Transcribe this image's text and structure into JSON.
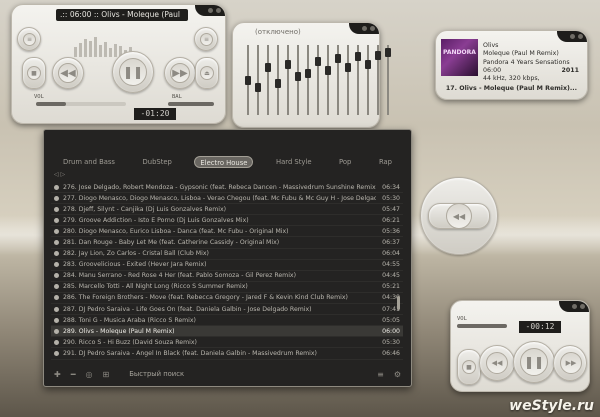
{
  "mini_player": {
    "title": ".:: 06:00 :: Olivs - Moleque (Paul",
    "time": "-01:20",
    "label_vol": "VOL",
    "label_bal": "BAL"
  },
  "equalizer": {
    "status": "(отключено)",
    "bands": [
      0.5,
      0.62,
      0.3,
      0.55,
      0.25,
      0.45,
      0.4,
      0.2,
      0.35,
      0.15,
      0.3,
      0.12,
      0.25,
      0.1,
      0.05
    ]
  },
  "now_playing": {
    "artist": "Olivs",
    "track": "Moleque (Paul M Remix)",
    "album": "Pandora 4 Years Sensations",
    "time": "06:00",
    "year": "2011",
    "format": "44 kHz, 320 kbps,",
    "art_text": "PANDORA",
    "footer": "17. Olivs - Moleque (Paul M Remix)..."
  },
  "playlist": {
    "tabs": [
      {
        "label": "Drum and Bass",
        "active": false
      },
      {
        "label": "DubStep",
        "active": false
      },
      {
        "label": "Electro House",
        "active": true
      },
      {
        "label": "Hard Style",
        "active": false
      },
      {
        "label": "Pop",
        "active": false
      },
      {
        "label": "Rap",
        "active": false
      }
    ],
    "nav": "◁ ▷",
    "rows": [
      {
        "title": "276. Jose Delgado, Robert Mendoza - Gypsonic (feat. Rebeca Dancen - Massivedrum Sunshine Remix)",
        "dur": "06:34"
      },
      {
        "title": "277. Diogo Menasco, Diogo Menasco, Lisboa - Verao Chegou (feat. Mc Fubu & Mc Guy H - Jose Delgado Remix)",
        "dur": "05:30"
      },
      {
        "title": "278. Djeff, Silynt - Canjika (Dj Luis Gonzalves Remix)",
        "dur": "05:47"
      },
      {
        "title": "279. Groove Addiction - Isto E Porno (Dj Luis Gonzalves Mix)",
        "dur": "06:21"
      },
      {
        "title": "280. Diogo Menasco, Eurico Lisboa - Danca (feat. Mc Fubu - Original Mix)",
        "dur": "05:36"
      },
      {
        "title": "281. Dan Rouge - Baby Let Me (feat. Catherine Cassidy - Original Mix)",
        "dur": "06:37"
      },
      {
        "title": "282. Jay Lion, Zo Carlos - Cristal Ball (Club Mix)",
        "dur": "06:04"
      },
      {
        "title": "283. Groovelicious - Exited (Hever Jara Remix)",
        "dur": "04:55"
      },
      {
        "title": "284. Manu Serrano - Red Rose 4 Her (feat. Pablo Somoza - Gil Perez Remix)",
        "dur": "04:45"
      },
      {
        "title": "285. Marcello Totti - All Night Long (Ricco S Summer Remix)",
        "dur": "05:21"
      },
      {
        "title": "286. The Foreign Brothers - Move (feat. Rebecca Gregory - Jared F & Kevin Kind Club Remix)",
        "dur": "04:30"
      },
      {
        "title": "287. DJ Pedro Saraiva - Life Goes On (feat. Daniela Galbin - Jose Delgado Remix)",
        "dur": "07:41"
      },
      {
        "title": "288. Toni G - Musica Araba (Ricco S Remix)",
        "dur": "05:05"
      },
      {
        "title": "289. Olivs - Moleque (Paul M Remix)",
        "dur": "06:00",
        "current": true
      },
      {
        "title": "290. Ricco S - Hi Buzz (David Souza Remix)",
        "dur": "05:30"
      },
      {
        "title": "291. DJ Pedro Saraiva - Angel In Black (feat. Daniela Galbin - Massivedrum Remix)",
        "dur": "06:46"
      }
    ],
    "search_label": "Быстрый поиск"
  },
  "remote": {
    "center": "◀◀"
  },
  "bottom_player": {
    "time": "-00:12",
    "label_vol": "VOL",
    "label_bal": "BAL"
  },
  "watermark": "weStyle.ru"
}
